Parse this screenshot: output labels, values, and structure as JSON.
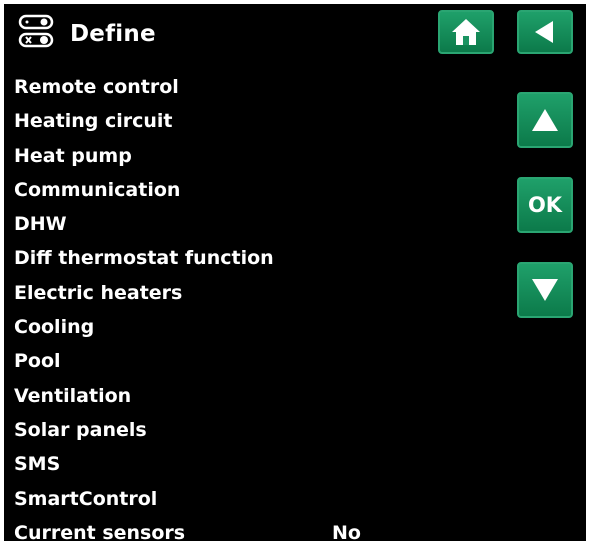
{
  "header": {
    "title": "Define",
    "icon": "settings-toggle-icon"
  },
  "buttons": {
    "home_icon": "home-icon",
    "back_icon": "back-arrow-icon",
    "up_icon": "up-arrow-icon",
    "ok_label": "OK",
    "down_icon": "down-arrow-icon"
  },
  "menu": {
    "items": [
      {
        "label": "Remote control",
        "value": ""
      },
      {
        "label": "Heating circuit",
        "value": ""
      },
      {
        "label": "Heat pump",
        "value": ""
      },
      {
        "label": "Communication",
        "value": ""
      },
      {
        "label": "DHW",
        "value": ""
      },
      {
        "label": "Diff thermostat function",
        "value": ""
      },
      {
        "label": "Electric heaters",
        "value": ""
      },
      {
        "label": "Cooling",
        "value": ""
      },
      {
        "label": "Pool",
        "value": ""
      },
      {
        "label": "Ventilation",
        "value": ""
      },
      {
        "label": "Solar panels",
        "value": ""
      },
      {
        "label": "SMS",
        "value": ""
      },
      {
        "label": "SmartControl",
        "value": ""
      },
      {
        "label": "Current sensors",
        "value": "No"
      }
    ]
  },
  "colors": {
    "background": "#000000",
    "accent": "#138a56",
    "text": "#ffffff"
  }
}
